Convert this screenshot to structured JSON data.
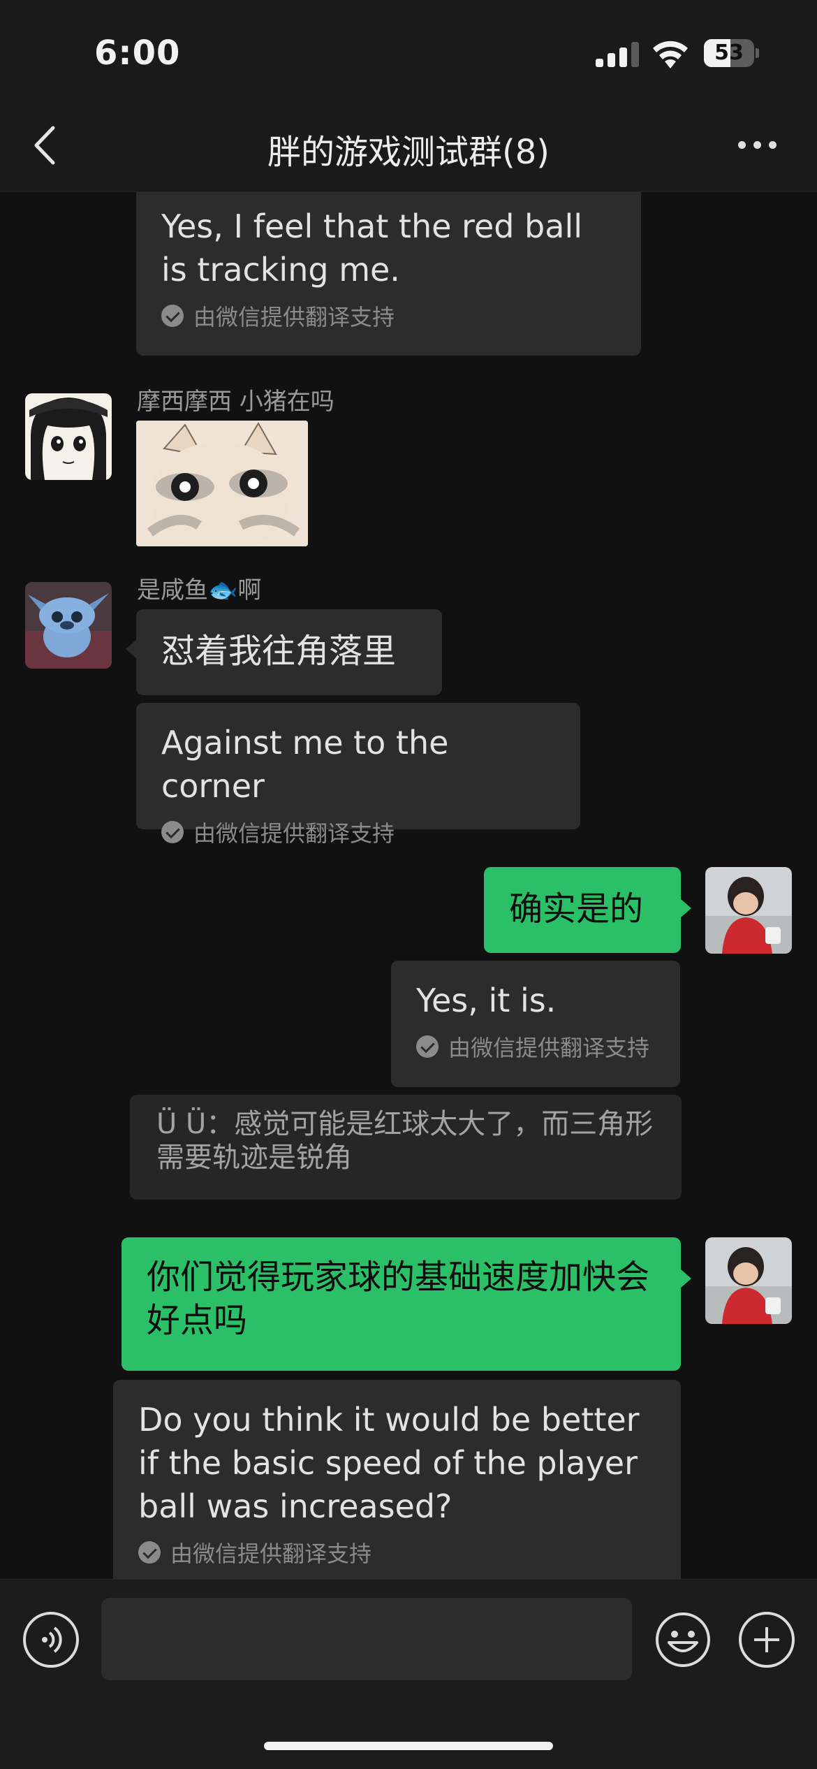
{
  "status_bar": {
    "time": "6:00",
    "battery": "53"
  },
  "nav": {
    "title": "胖的游戏测试群(8)"
  },
  "messages": {
    "m1": {
      "text": "Yes, I feel that the red ball is tracking me.",
      "translation_note": "由微信提供翻译支持"
    },
    "m2": {
      "sender": "摩西摩西 小猪在吗",
      "sticker": "cat-sticker"
    },
    "m3": {
      "sender": "是咸鱼🐟啊",
      "text": "怼着我往角落里"
    },
    "m4": {
      "text": "Against me to the corner",
      "translation_note": "由微信提供翻译支持"
    },
    "m5": {
      "text": "确实是的"
    },
    "m6": {
      "text": "Yes, it is.",
      "translation_note": "由微信提供翻译支持"
    },
    "m7": {
      "quote": "Ü Ü：感觉可能是红球太大了，而三角形需要轨迹是锐角"
    },
    "m8": {
      "text": "你们觉得玩家球的基础速度加快会好点吗"
    },
    "m9": {
      "text": "Do you think it would be better if the basic speed of the player ball was increased?",
      "translation_note": "由微信提供翻译支持"
    }
  },
  "input": {
    "placeholder": ""
  },
  "colors": {
    "outgoing_bubble": "#2bc067",
    "incoming_bubble": "#2c2c2c",
    "background": "#111111"
  }
}
